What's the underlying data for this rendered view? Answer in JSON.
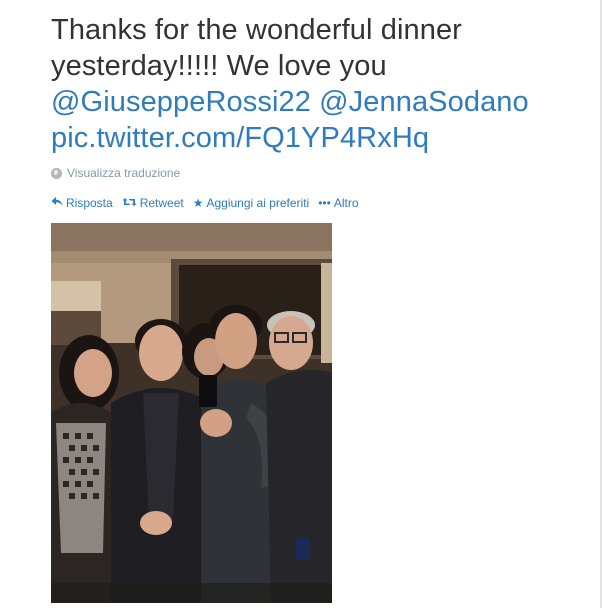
{
  "tweet": {
    "text_line1": "Thanks for the wonderful dinner",
    "text_line2": "yesterday!!!!! We love you",
    "mention1": "@GiuseppeRossi22",
    "mention2": "@JennaSodano",
    "link": "pic.twitter.com/FQ1YP4RxHq"
  },
  "translate_label": "Visualizza traduzione",
  "actions": {
    "reply": "Risposta",
    "retweet": "Retweet",
    "favorite": "Aggiungi ai preferiti",
    "more": "Altro"
  },
  "icons": {
    "reply": "reply-icon",
    "retweet": "retweet-icon",
    "favorite": "star-icon",
    "more": "ellipsis-icon",
    "translate": "globe-icon"
  },
  "colors": {
    "link": "#2f7bbf",
    "text": "#333333",
    "muted": "#8899a6"
  }
}
